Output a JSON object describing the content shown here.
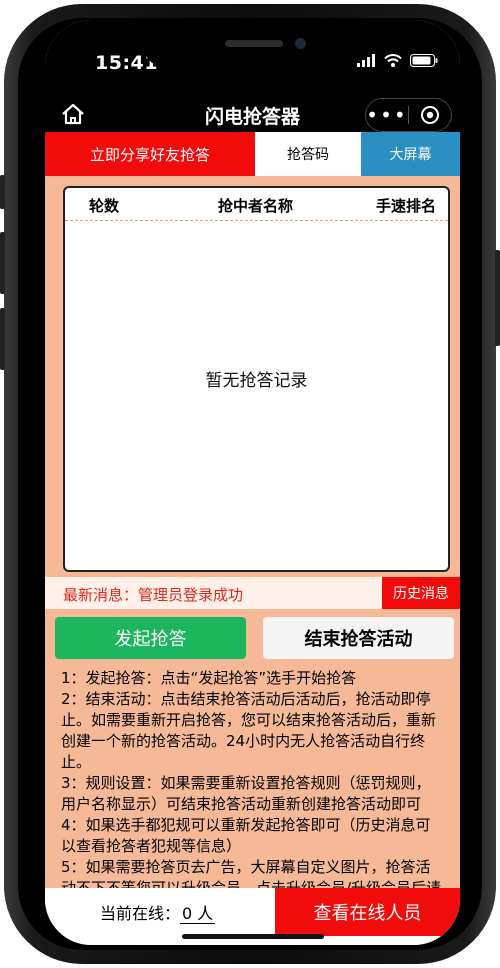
{
  "status": {
    "time": "15:41"
  },
  "nav": {
    "title": "闪电抢答器",
    "more": "•••"
  },
  "tabs": [
    {
      "label": "立即分享好友抢答"
    },
    {
      "label": "抢答码"
    },
    {
      "label": "大屏幕"
    }
  ],
  "table": {
    "headers": [
      "轮数",
      "抢中者名称",
      "手速排名"
    ],
    "empty_text": "暂无抢答记录"
  },
  "news": {
    "text": "最新消息：管理员登录成功",
    "history_label": "历史消息"
  },
  "actions": {
    "start_label": "发起抢答",
    "end_label": "结束抢答活动"
  },
  "rules": [
    "1：发起抢答：点击“发起抢答”选手开始抢答",
    "2：结束活动：点击结束抢答活动后活动后，抢活动即停止。如需要重新开启抢答，您可以结束抢答活动后，重新创建一个新的抢答活动。24小时内无人抢答活动自行终止。",
    "3：规则设置：如果需要重新设置抢答规则（惩罚规则，用户名称显示）可结束抢答活动重新创建抢答活动即可",
    "4：如果选手都犯规可以重新发起抢答即可（历史消息可以查看抢答者犯规等信息）",
    "5：如果需要抢答页去广告，大屏幕自定义图片，抢答活动不下不等您可以升级会员，点击升级会员/升级会员后请"
  ],
  "bottom": {
    "online_label": "当前在线：",
    "online_value": "0 人",
    "view_online_label": "查看在线人员"
  },
  "colors": {
    "red": "#f20b0b",
    "green": "#1cb65e",
    "blue": "#2a8fc3",
    "page_bg": "#f6b997"
  }
}
